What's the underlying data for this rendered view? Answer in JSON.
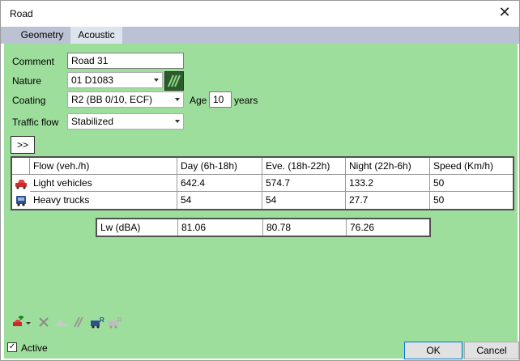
{
  "window": {
    "title": "Road"
  },
  "tabs": [
    {
      "label": "Geometry"
    },
    {
      "label": "Acoustic"
    }
  ],
  "form": {
    "comment_label": "Comment",
    "comment_value": "Road 31",
    "nature_label": "Nature",
    "nature_value": "01 D1083",
    "coating_label": "Coating",
    "coating_value": "R2 (BB 0/10, ECF)",
    "age_label": "Age",
    "age_value": "10",
    "age_unit": "years",
    "traffic_label": "Traffic flow",
    "traffic_value": "Stabilized",
    "expand_label": ">>"
  },
  "grid": {
    "headers": [
      "Flow (veh./h)",
      "Day (6h-18h)",
      "Eve. (18h-22h)",
      "Night (22h-6h)",
      "Speed (Km/h)"
    ],
    "rows": [
      {
        "name": "Light vehicles",
        "icon": "car-icon",
        "day": "642.4",
        "eve": "574.7",
        "night": "133.2",
        "speed": "50"
      },
      {
        "name": "Heavy trucks",
        "icon": "truck-icon",
        "day": "54",
        "eve": "54",
        "night": "27.7",
        "speed": "50"
      }
    ]
  },
  "lw": {
    "label": "Lw (dBA)",
    "day": "81.06",
    "eve": "80.78",
    "night": "76.26"
  },
  "footer": {
    "active_label": "Active",
    "active_checked": true,
    "ok_label": "OK",
    "cancel_label": "Cancel"
  },
  "colors": {
    "panel": "#9ede9c",
    "tabstrip": "#bac2d3",
    "selected_tab": "#dce4ee"
  }
}
